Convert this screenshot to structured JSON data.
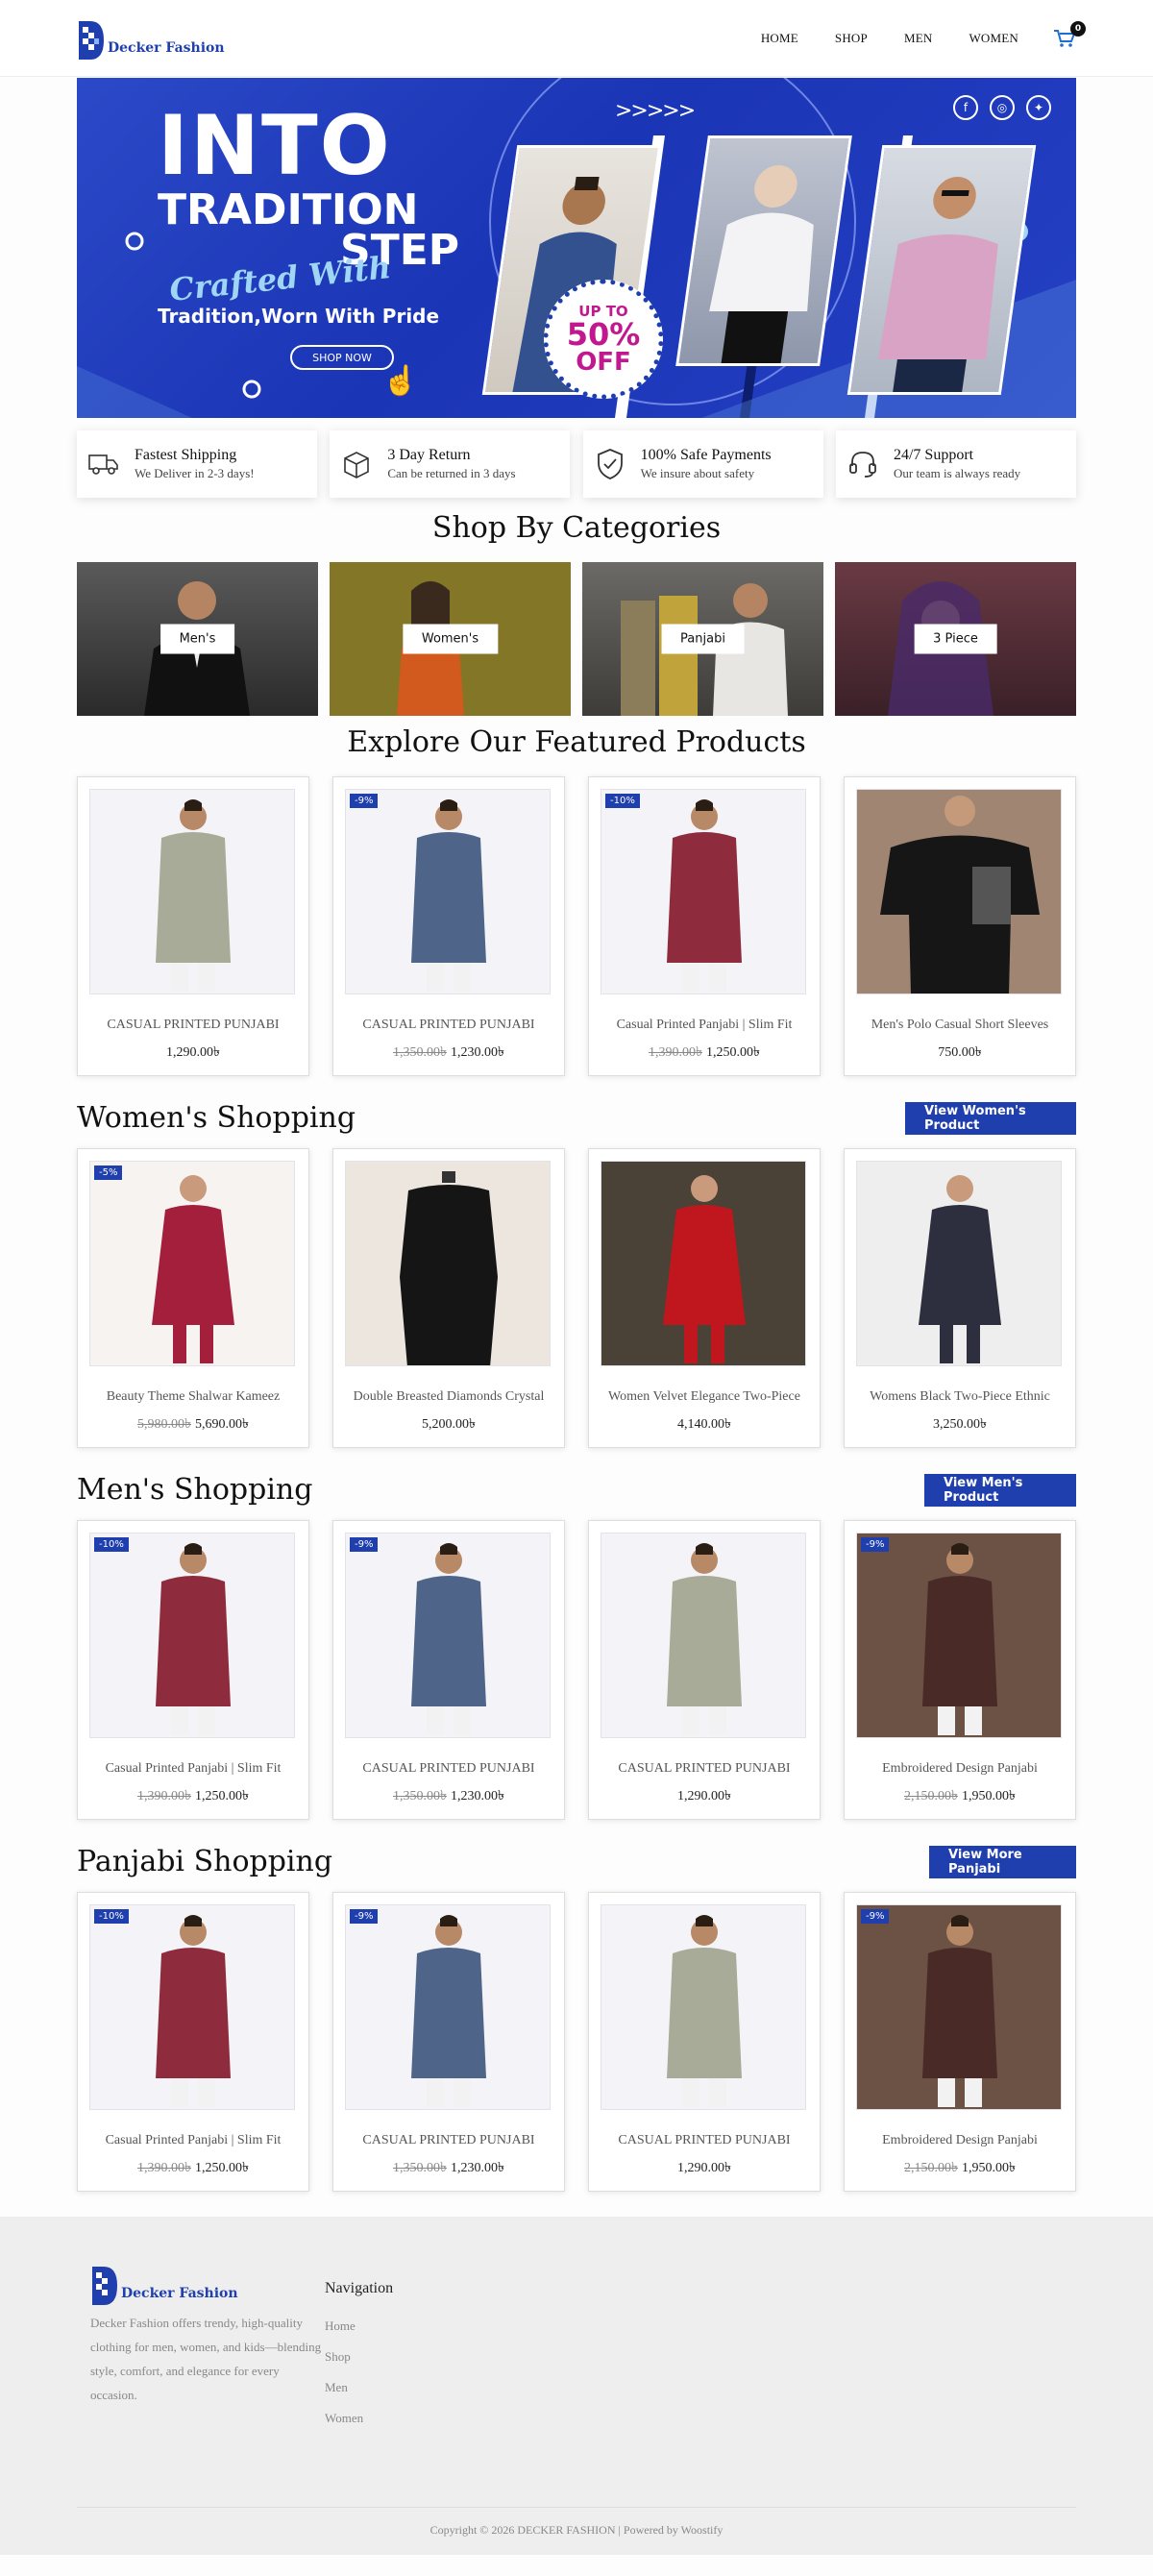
{
  "brand": {
    "name": "Decker Fashion"
  },
  "nav": {
    "items": [
      "HOME",
      "SHOP",
      "MEN",
      "WOMEN"
    ],
    "cart_count": "0"
  },
  "hero": {
    "line1": "INTO",
    "line2": "TRADITION",
    "line3": "STEP",
    "script": "Crafted With",
    "subtitle": "Tradition,Worn With Pride",
    "button": "SHOP NOW",
    "arrows": ">>>>>",
    "offer_top": "UP TO",
    "offer_pct": "50%",
    "offer_bottom": "OFF",
    "colors": {
      "primary": "#1f3fae",
      "offer": "#c2188f",
      "accent": "#9fd6f5"
    }
  },
  "features": [
    {
      "icon": "truck-icon",
      "title": "Fastest Shipping",
      "desc": "We Deliver in 2-3 days!"
    },
    {
      "icon": "box-icon",
      "title": "3 Day Return",
      "desc": "Can be returned in 3 days"
    },
    {
      "icon": "shield-check-icon",
      "title": "100% Safe Payments",
      "desc": "We insure about safety"
    },
    {
      "icon": "headset-icon",
      "title": "24/7 Support",
      "desc": "Our team is always ready"
    }
  ],
  "categories": {
    "title": "Shop By Categories",
    "items": [
      "Men's",
      "Women's",
      "Panjabi",
      "3 Piece"
    ]
  },
  "featured": {
    "title": "Explore Our Featured Products",
    "products": [
      {
        "name": "CASUAL PRINTED PUNJABI",
        "old": "",
        "price": "1,290.00৳",
        "disc": ""
      },
      {
        "name": "CASUAL PRINTED PUNJABI",
        "old": "1,350.00৳",
        "price": "1,230.00৳",
        "disc": "-9%"
      },
      {
        "name": "Casual Printed Panjabi | Slim Fit",
        "old": "1,390.00৳",
        "price": "1,250.00৳",
        "disc": "-10%"
      },
      {
        "name": "Men's Polo Casual Short Sleeves",
        "old": "",
        "price": "750.00৳",
        "disc": ""
      }
    ]
  },
  "women": {
    "title": "Women's Shopping",
    "button": "View Women's Product",
    "products": [
      {
        "name": "Beauty Theme Shalwar Kameez",
        "old": "5,980.00৳",
        "price": "5,690.00৳",
        "disc": "-5%"
      },
      {
        "name": "Double Breasted Diamonds Crystal",
        "old": "",
        "price": "5,200.00৳",
        "disc": ""
      },
      {
        "name": "Women Velvet Elegance Two-Piece",
        "old": "",
        "price": "4,140.00৳",
        "disc": ""
      },
      {
        "name": "Womens Black Two-Piece Ethnic",
        "old": "",
        "price": "3,250.00৳",
        "disc": ""
      }
    ]
  },
  "men": {
    "title": "Men's Shopping",
    "button": "View Men's Product",
    "products": [
      {
        "name": "Casual Printed Panjabi | Slim Fit",
        "old": "1,390.00৳",
        "price": "1,250.00৳",
        "disc": "-10%"
      },
      {
        "name": "CASUAL PRINTED PUNJABI",
        "old": "1,350.00৳",
        "price": "1,230.00৳",
        "disc": "-9%"
      },
      {
        "name": "CASUAL PRINTED PUNJABI",
        "old": "",
        "price": "1,290.00৳",
        "disc": ""
      },
      {
        "name": "Embroidered Design Panjabi",
        "old": "2,150.00৳",
        "price": "1,950.00৳",
        "disc": "-9%"
      }
    ]
  },
  "panjabi": {
    "title": "Panjabi Shopping",
    "button": "View More Panjabi",
    "products": [
      {
        "name": "Casual Printed Panjabi | Slim Fit",
        "old": "1,390.00৳",
        "price": "1,250.00৳",
        "disc": "-10%"
      },
      {
        "name": "CASUAL PRINTED PUNJABI",
        "old": "1,350.00৳",
        "price": "1,230.00৳",
        "disc": "-9%"
      },
      {
        "name": "CASUAL PRINTED PUNJABI",
        "old": "",
        "price": "1,290.00৳",
        "disc": ""
      },
      {
        "name": "Embroidered Design Panjabi",
        "old": "2,150.00৳",
        "price": "1,950.00৳",
        "disc": "-9%"
      }
    ]
  },
  "footer": {
    "about": "Decker Fashion offers trendy, high-quality clothing for men, women, and kids—blending style, comfort, and elegance for every occasion.",
    "nav_title": "Navigation",
    "nav_items": [
      "Home",
      "Shop",
      "Men",
      "Women"
    ],
    "copyright": "Copyright © 2026 DECKER FASHION | Powered by Woostify"
  }
}
